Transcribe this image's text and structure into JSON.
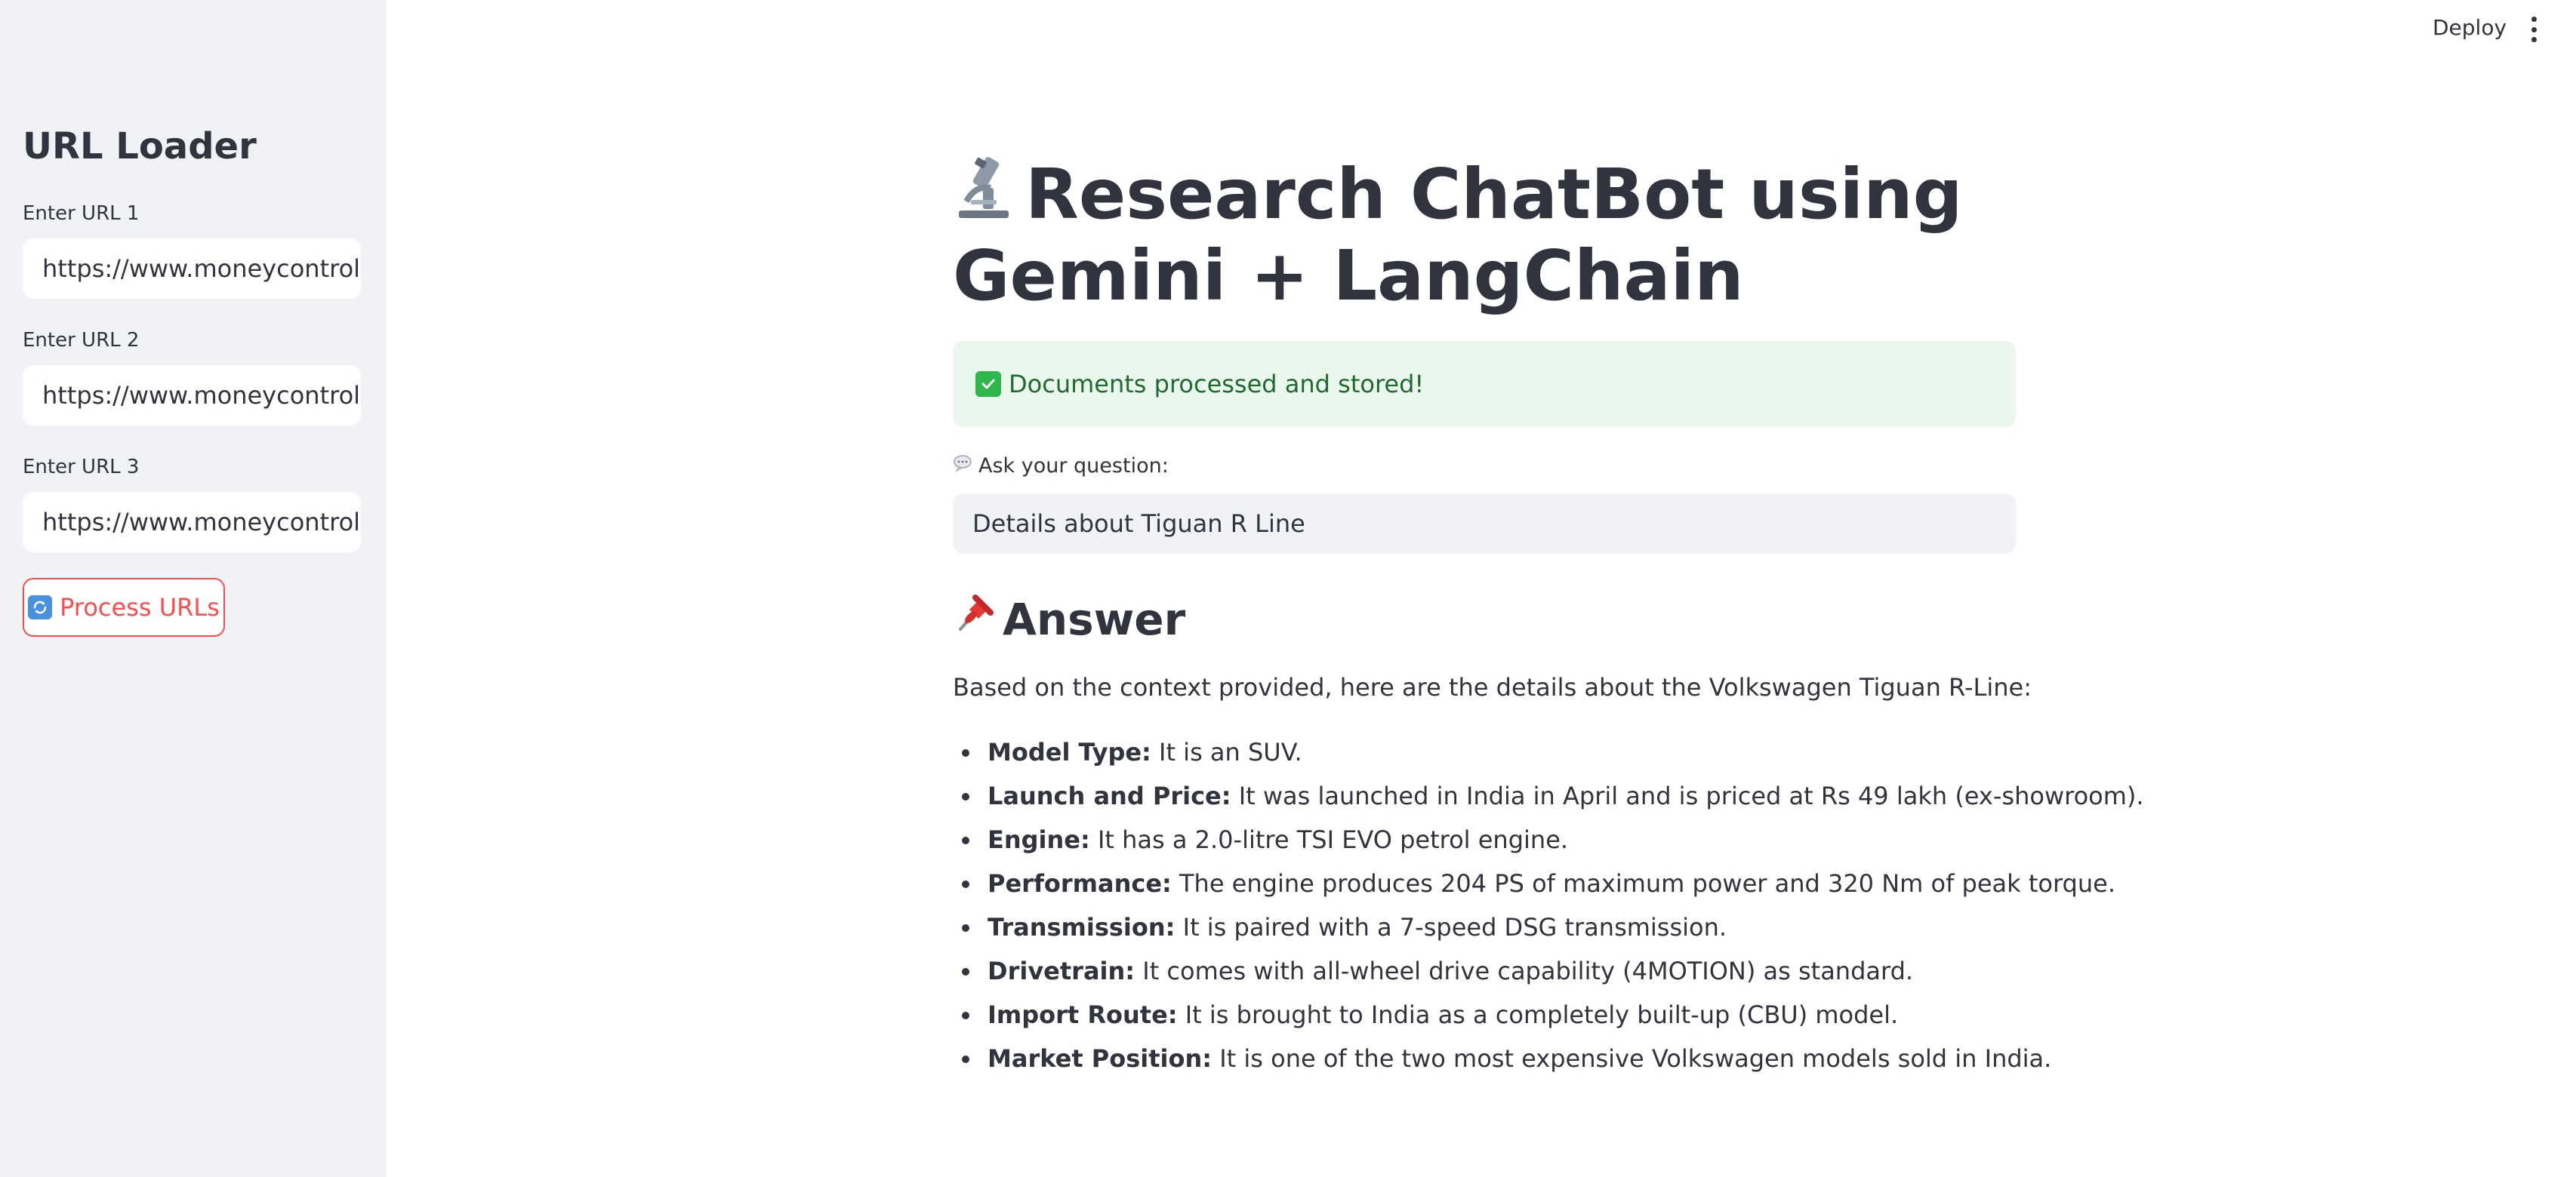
{
  "toolbar": {
    "deploy_label": "Deploy"
  },
  "sidebar": {
    "title": "URL Loader",
    "fields": [
      {
        "label": "Enter URL 1",
        "value": "https://www.moneycontrol.co"
      },
      {
        "label": "Enter URL 2",
        "value": "https://www.moneycontrol.co"
      },
      {
        "label": "Enter URL 3",
        "value": "https://www.moneycontrol.co"
      }
    ],
    "process_button_label": "Process URLs"
  },
  "main": {
    "title": "Research ChatBot using Gemini + LangChain",
    "success_message": "Documents processed and stored!",
    "question_label": "Ask your question:",
    "question_value": "Details about Tiguan R Line",
    "answer_heading": "Answer",
    "answer_intro": "Based on the context provided, here are the details about the Volkswagen Tiguan R-Line:",
    "answer_items": [
      {
        "key": "Model Type:",
        "text": " It is an SUV."
      },
      {
        "key": "Launch and Price:",
        "text": " It was launched in India in April and is priced at Rs 49 lakh (ex-showroom)."
      },
      {
        "key": "Engine:",
        "text": " It has a 2.0-litre TSI EVO petrol engine."
      },
      {
        "key": "Performance:",
        "text": " The engine produces 204 PS of maximum power and 320 Nm of peak torque."
      },
      {
        "key": "Transmission:",
        "text": " It is paired with a 7-speed DSG transmission."
      },
      {
        "key": "Drivetrain:",
        "text": " It comes with all-wheel drive capability (4MOTION) as standard."
      },
      {
        "key": "Import Route:",
        "text": " It is brought to India as a completely built-up (CBU) model."
      },
      {
        "key": "Market Position:",
        "text": " It is one of the two most expensive Volkswagen models sold in India."
      }
    ]
  },
  "icons": {
    "title": "microscope-icon",
    "success": "check-mark-icon",
    "question": "speech-bubble-icon",
    "answer": "pushpin-icon",
    "process": "refresh-icon",
    "menu": "kebab-menu-icon"
  },
  "colors": {
    "accent": "#ff4b4b",
    "sidebar_bg": "#f0f2f6",
    "success_bg": "#eaf7ec",
    "success_text": "#1f6b2f",
    "text": "#31333f"
  }
}
